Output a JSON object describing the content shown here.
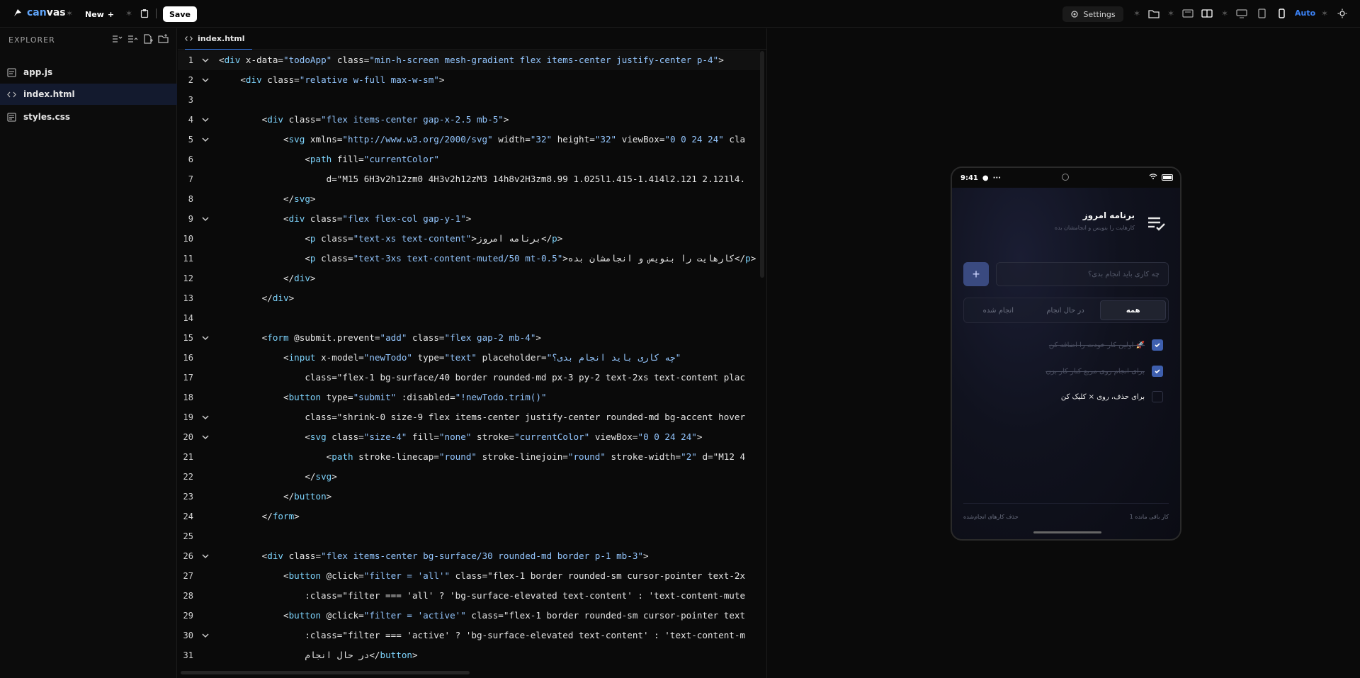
{
  "app": {
    "logo_prefix": "can",
    "logo_suffix": "vas",
    "new_label": "New",
    "save_label": "Save",
    "settings_label": "Settings",
    "auto_label": "Auto"
  },
  "explorer": {
    "title": "EXPLORER",
    "files": [
      {
        "name": "app.js",
        "icon": "js-file-icon"
      },
      {
        "name": "index.html",
        "icon": "code-icon"
      },
      {
        "name": "styles.css",
        "icon": "css-file-icon"
      }
    ]
  },
  "editor": {
    "tab_label": "index.html",
    "lines": [
      {
        "n": "1",
        "fold": true,
        "code": "<div x-data=\"todoApp\" class=\"min-h-screen mesh-gradient flex items-center justify-center p-4\">"
      },
      {
        "n": "2",
        "fold": true,
        "code": "    <div class=\"relative w-full max-w-sm\">"
      },
      {
        "n": "3",
        "fold": false,
        "code": ""
      },
      {
        "n": "4",
        "fold": true,
        "code": "        <div class=\"flex items-center gap-x-2.5 mb-5\">"
      },
      {
        "n": "5",
        "fold": true,
        "code": "            <svg xmlns=\"http://www.w3.org/2000/svg\" width=\"32\" height=\"32\" viewBox=\"0 0 24 24\" cla"
      },
      {
        "n": "6",
        "fold": false,
        "code": "                <path fill=\"currentColor\""
      },
      {
        "n": "7",
        "fold": false,
        "code": "                    d=\"M15 6H3v2h12zm0 4H3v2h12zM3 14h8v2H3zm8.99 1.025l1.415-1.414l2.121 2.121l4."
      },
      {
        "n": "8",
        "fold": false,
        "code": "            </svg>"
      },
      {
        "n": "9",
        "fold": true,
        "code": "            <div class=\"flex flex-col gap-y-1\">"
      },
      {
        "n": "10",
        "fold": false,
        "code": "                <p class=\"text-xs text-content\">برنامه امروز</p>"
      },
      {
        "n": "11",
        "fold": false,
        "code": "                <p class=\"text-3xs text-content-muted/50 mt-0.5\">کارهایت را بنویس و انجامشان بده</p>"
      },
      {
        "n": "12",
        "fold": false,
        "code": "            </div>"
      },
      {
        "n": "13",
        "fold": false,
        "code": "        </div>"
      },
      {
        "n": "14",
        "fold": false,
        "code": ""
      },
      {
        "n": "15",
        "fold": true,
        "code": "        <form @submit.prevent=\"add\" class=\"flex gap-2 mb-4\">"
      },
      {
        "n": "16",
        "fold": false,
        "code": "            <input x-model=\"newTodo\" type=\"text\" placeholder=\"چه کاری باید انجام بدی؟\""
      },
      {
        "n": "17",
        "fold": false,
        "code": "                class=\"flex-1 bg-surface/40 border rounded-md px-3 py-2 text-2xs text-content plac"
      },
      {
        "n": "18",
        "fold": false,
        "code": "            <button type=\"submit\" :disabled=\"!newTodo.trim()\""
      },
      {
        "n": "19",
        "fold": true,
        "code": "                class=\"shrink-0 size-9 flex items-center justify-center rounded-md bg-accent hover"
      },
      {
        "n": "20",
        "fold": true,
        "code": "                <svg class=\"size-4\" fill=\"none\" stroke=\"currentColor\" viewBox=\"0 0 24 24\">"
      },
      {
        "n": "21",
        "fold": false,
        "code": "                    <path stroke-linecap=\"round\" stroke-linejoin=\"round\" stroke-width=\"2\" d=\"M12 4"
      },
      {
        "n": "22",
        "fold": false,
        "code": "                </svg>"
      },
      {
        "n": "23",
        "fold": false,
        "code": "            </button>"
      },
      {
        "n": "24",
        "fold": false,
        "code": "        </form>"
      },
      {
        "n": "25",
        "fold": false,
        "code": ""
      },
      {
        "n": "26",
        "fold": true,
        "code": "        <div class=\"flex items-center bg-surface/30 rounded-md border p-1 mb-3\">"
      },
      {
        "n": "27",
        "fold": false,
        "code": "            <button @click=\"filter = 'all'\" class=\"flex-1 border rounded-sm cursor-pointer text-2x"
      },
      {
        "n": "28",
        "fold": false,
        "code": "                :class=\"filter === 'all' ? 'bg-surface-elevated text-content' : 'text-content-mute"
      },
      {
        "n": "29",
        "fold": false,
        "code": "            <button @click=\"filter = 'active'\" class=\"flex-1 border rounded-sm cursor-pointer text"
      },
      {
        "n": "30",
        "fold": true,
        "code": "                :class=\"filter === 'active' ? 'bg-surface-elevated text-content' : 'text-content-m"
      },
      {
        "n": "31",
        "fold": false,
        "code": "                در حال انجام</button>"
      }
    ]
  },
  "preview": {
    "time": "9:41",
    "title": "برنامه امروز",
    "subtitle": "کارهایت را بنویس و انجامشان بده",
    "input_placeholder": "چه کاری باید انجام بدی؟",
    "add_symbol": "+",
    "filters": [
      {
        "label": "همه",
        "active": true
      },
      {
        "label": "در حال انجام",
        "active": false
      },
      {
        "label": "انجام شده",
        "active": false
      }
    ],
    "todos": [
      {
        "text": "اولین کار خودت را اضافه کن 🚀",
        "done": true
      },
      {
        "text": "برای انجام روی مربع کنار کار بزن",
        "done": true
      },
      {
        "text": "برای حذف، روی × کلیک کن",
        "done": false
      }
    ],
    "remaining": "1 کار باقی مانده",
    "clear_done": "حذف کارهای انجام‌شده",
    "accent": "#3b82f6"
  }
}
